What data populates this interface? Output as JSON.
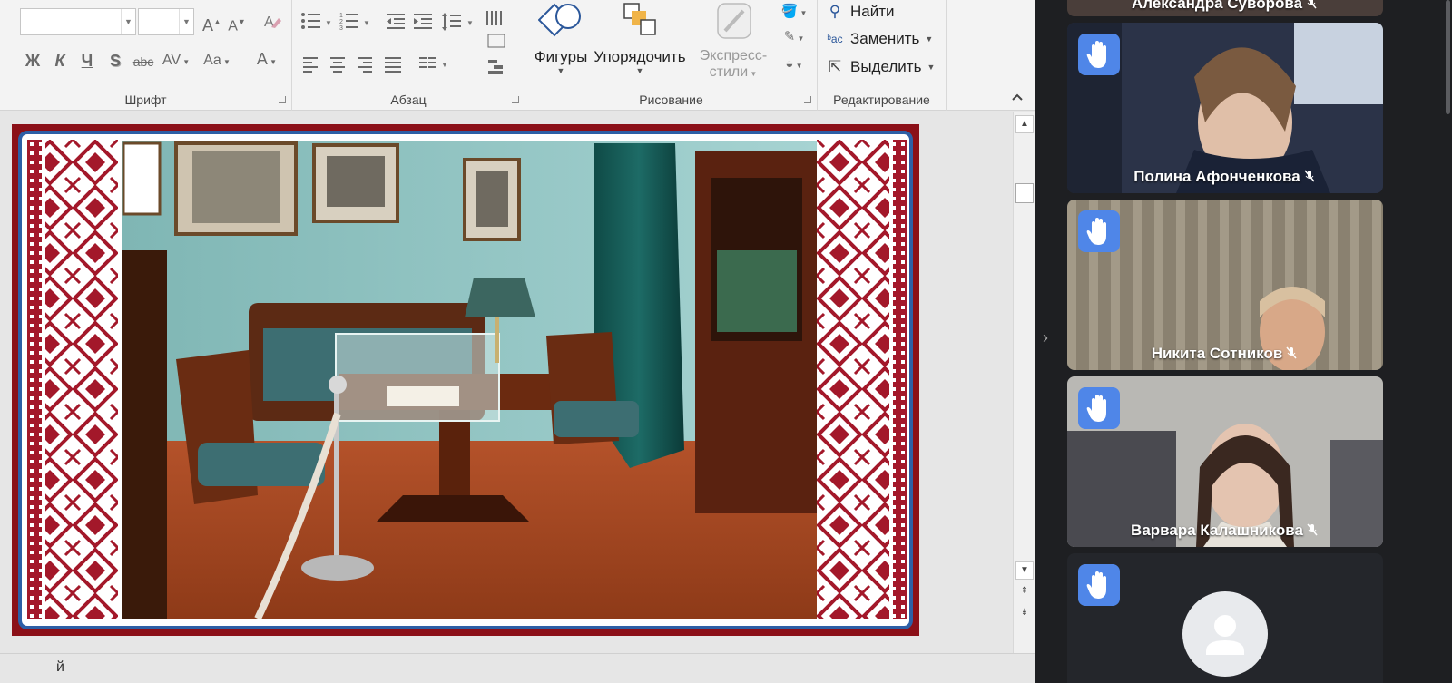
{
  "ribbon": {
    "groups": {
      "font": "Шрифт",
      "paragraph": "Абзац",
      "drawing": "Рисование",
      "editing": "Редактирование"
    },
    "font": {
      "bold": "Ж",
      "italic": "К",
      "underline": "Ч",
      "shadow": "S",
      "strike": "abc",
      "spacing": "AV",
      "case": "Aa",
      "color": "A",
      "grow": "A",
      "shrink": "A"
    },
    "drawing": {
      "shapes": "Фигуры",
      "arrange": "Упорядочить",
      "quick_styles_line1": "Экспресс-",
      "quick_styles_line2": "стили"
    },
    "editing": {
      "find": "Найти",
      "replace": "Заменить",
      "select": "Выделить"
    }
  },
  "status": {
    "partial": "й"
  },
  "participants": [
    {
      "name": "Александра Суворова",
      "hand_raised": false,
      "muted": true
    },
    {
      "name": "Полина Афонченкова",
      "hand_raised": true,
      "muted": true
    },
    {
      "name": "Никита Сотников",
      "hand_raised": true,
      "muted": true
    },
    {
      "name": "Варвара Калашникова",
      "hand_raised": true,
      "muted": true
    },
    {
      "name": "",
      "hand_raised": true,
      "muted": true,
      "avatar": "default-avatar"
    }
  ],
  "colors": {
    "hand_badge": "#4f86e8",
    "slide_frame": "#8b1018",
    "slide_border": "#2d5fa6",
    "ornament": "#a3182a",
    "call_bg": "#1e1f22"
  }
}
